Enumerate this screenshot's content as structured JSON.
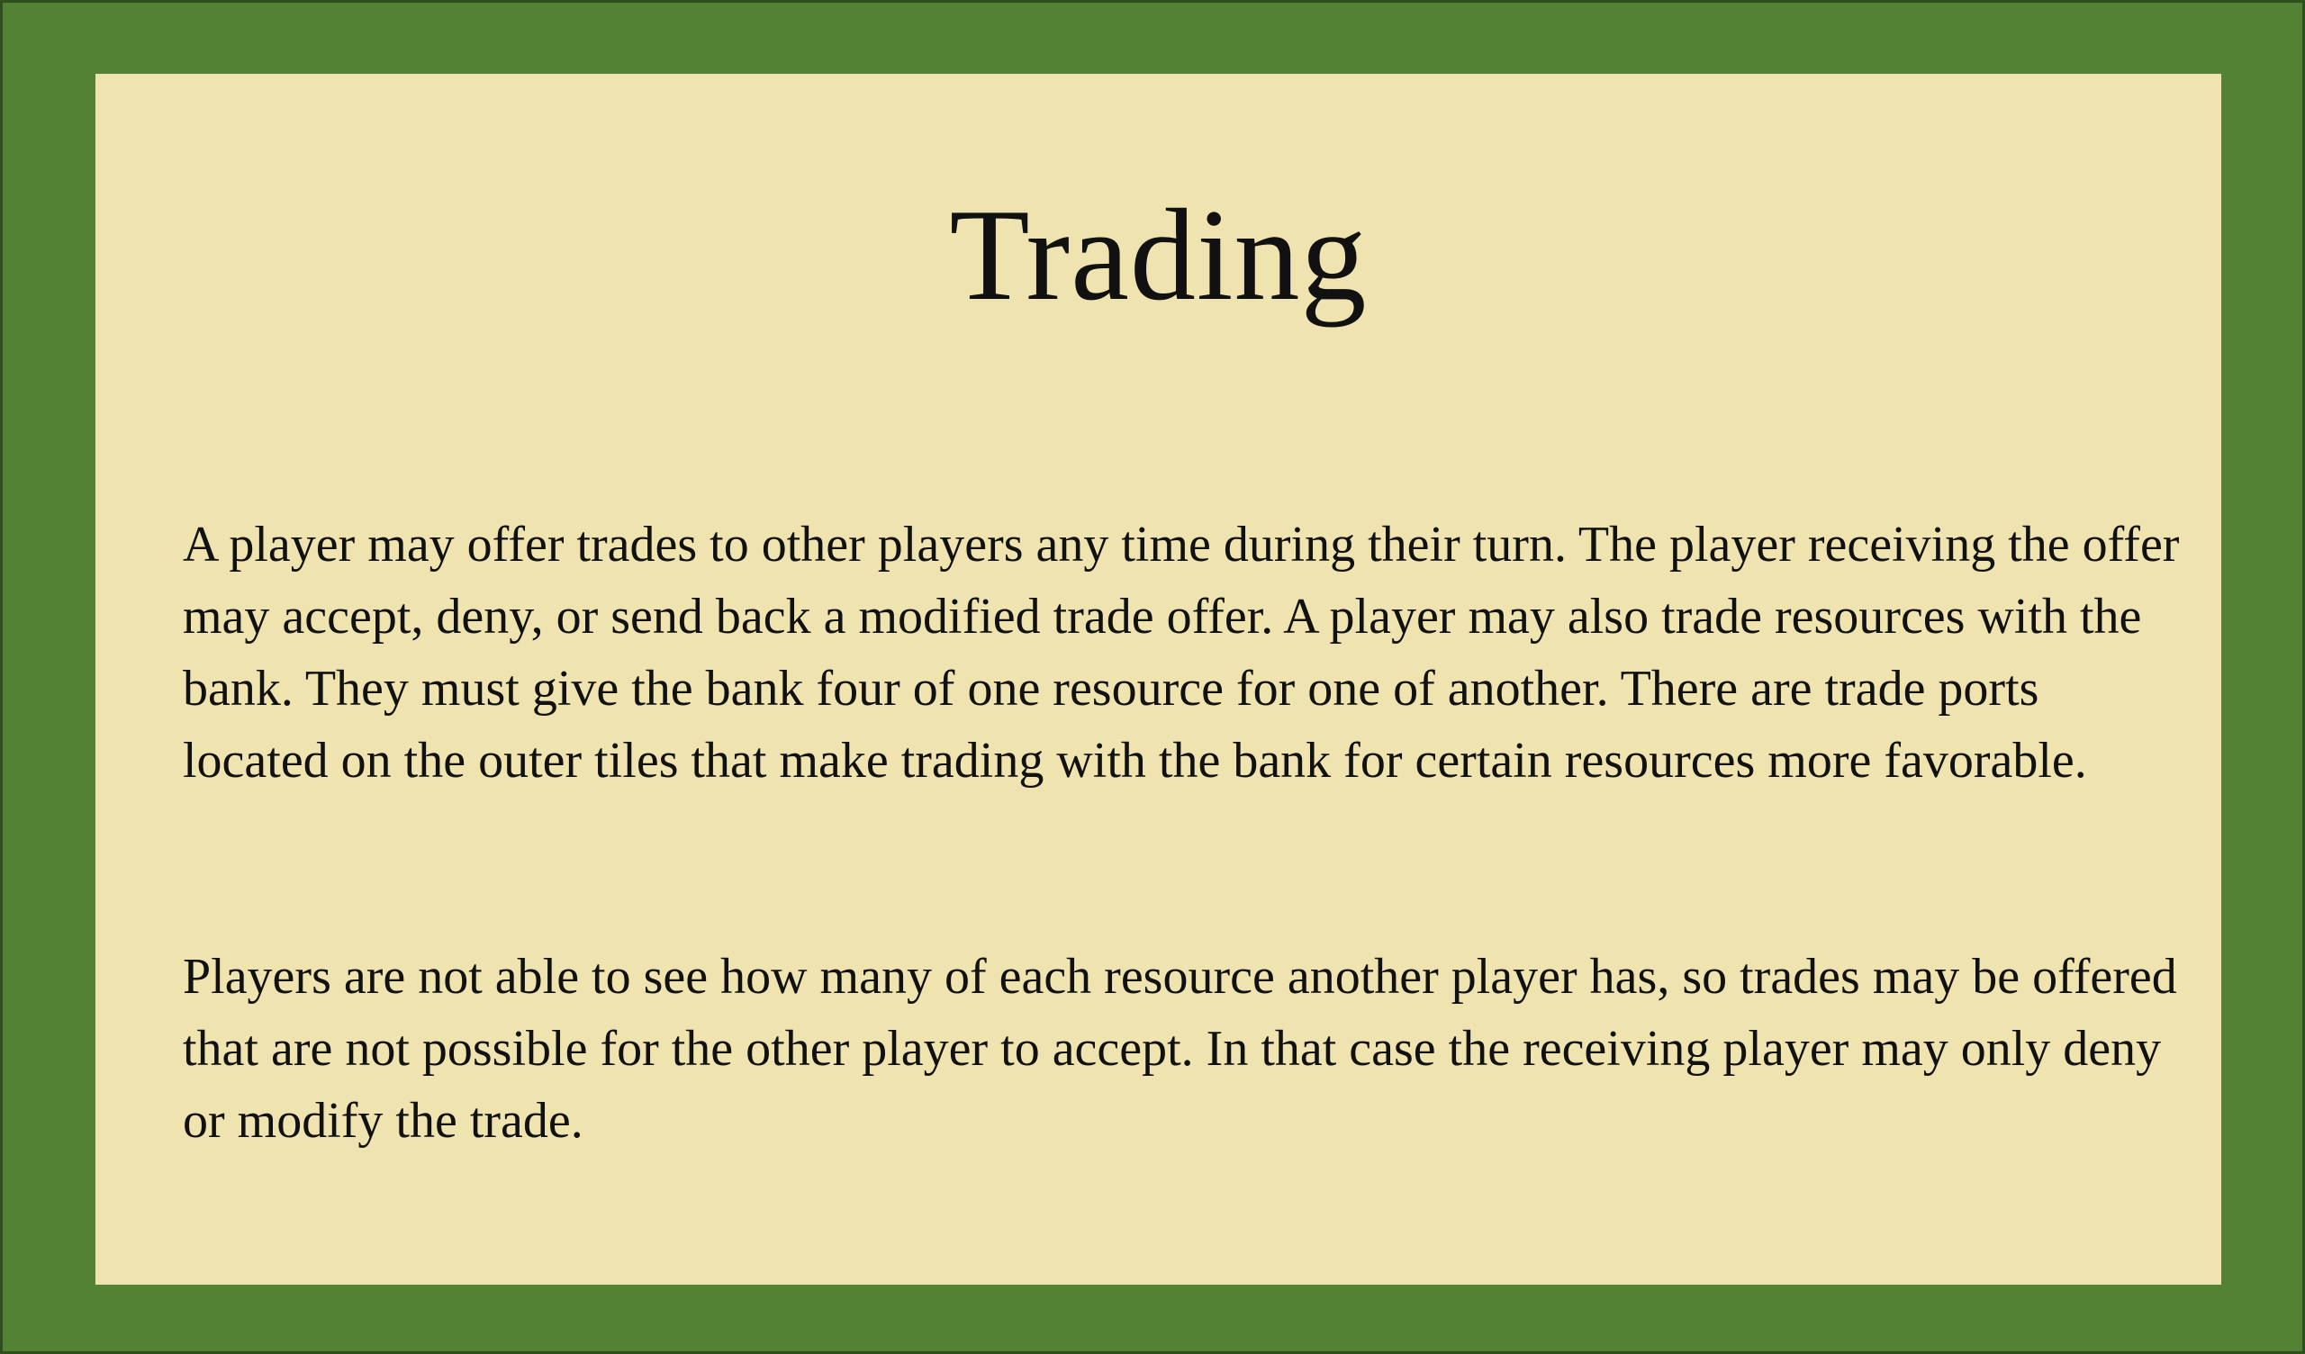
{
  "slide": {
    "title": "Trading",
    "paragraphs": [
      "A player may offer trades to other players any time during their turn. The player receiving the offer may accept, deny, or send back a modified trade offer. A player may also trade resources with the bank. They must give the bank four of one resource for one of another. There are trade ports located on the outer tiles that make trading with the bank for certain resources more favorable.",
      "Players are not able to see how many of each resource another player has, so trades may be offered that are not possible for the other player to accept. In that case the receiving player may only deny or modify the trade."
    ]
  },
  "colors": {
    "border": "#548235",
    "panel": "#efe4af",
    "text": "#111111"
  }
}
